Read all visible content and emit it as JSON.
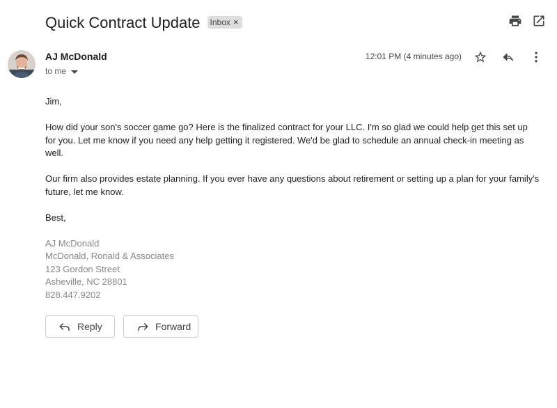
{
  "email": {
    "subject": "Quick Contract Update",
    "label": "Inbox",
    "sender": {
      "name": "AJ McDonald",
      "recipient_text": "to me"
    },
    "timestamp": "12:01 PM (4 minutes ago)",
    "body": {
      "greeting": "Jim,",
      "paragraphs": [
        "How did your son's soccer game go? Here is the finalized contract for your LLC. I'm so glad we could help get this set up for you. Let me know if you need any help getting it registered. We'd be glad to schedule an annual check-in meeting as well.",
        "Our firm also provides estate planning. If you ever have any questions about retirement or setting up a plan for your family's future, let me know."
      ],
      "closing": "Best,",
      "signature": [
        "AJ McDonald",
        "McDonald, Ronald & Associates",
        "123 Gordon Street",
        "Asheville, NC 28801",
        "828.447.9202"
      ]
    }
  },
  "actions": {
    "reply_label": "Reply",
    "forward_label": "Forward"
  },
  "icons": {
    "print": "printer-icon",
    "open_new_window": "open-in-new-icon",
    "star": "star-icon",
    "reply": "reply-icon",
    "more": "more-vert-icon",
    "remove_label": "close-icon",
    "caret": "caret-down-icon"
  },
  "colors": {
    "text": "#222222",
    "signature": "#888888",
    "chip_bg": "#dddddd"
  }
}
